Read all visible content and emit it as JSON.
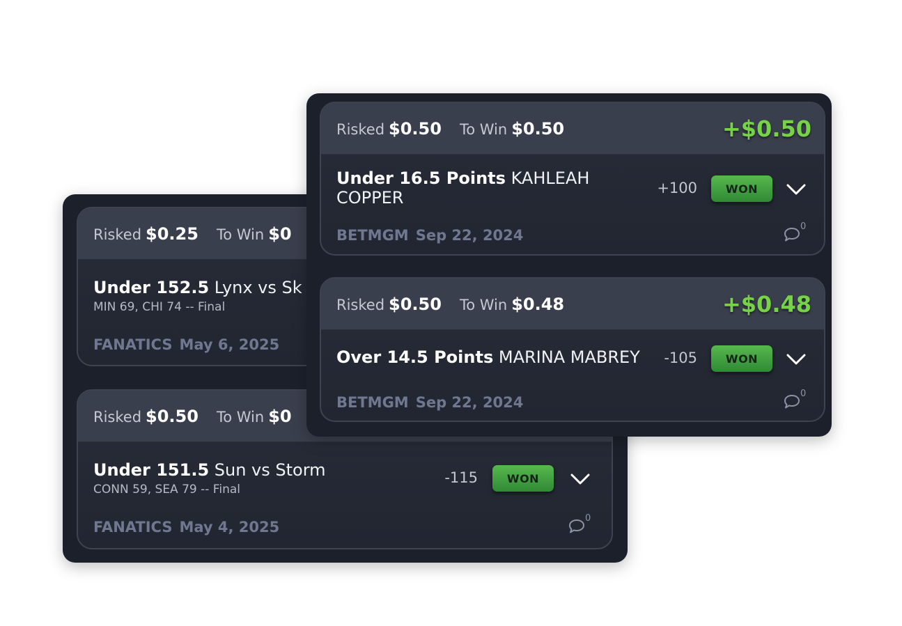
{
  "back_panel": {
    "cards": [
      {
        "risked_label": "Risked",
        "risked": "$0.25",
        "towin_label": "To Win",
        "towin": "$0",
        "title_bold": "Under 152.5",
        "title_rest": " Lynx vs Sk",
        "subtitle": "MIN 69, CHI 74 -- Final",
        "book": "FANATICS",
        "date": "May 6, 2025"
      },
      {
        "risked_label": "Risked",
        "risked": "$0.50",
        "towin_label": "To Win",
        "towin": "$0",
        "title_bold": "Under 151.5",
        "title_rest": " Sun vs Storm",
        "subtitle": "CONN 59, SEA 79 -- Final",
        "odds": "-115",
        "status": "WON",
        "book": "FANATICS",
        "date": "May 4, 2025",
        "comments": "0"
      }
    ]
  },
  "front_panel": {
    "cards": [
      {
        "risked_label": "Risked",
        "risked": "$0.50",
        "towin_label": "To Win",
        "towin": "$0.50",
        "profit": "+$0.50",
        "title_bold": "Under 16.5 Points",
        "title_rest": " KAHLEAH COPPER",
        "odds": "+100",
        "status": "WON",
        "book": "BETMGM",
        "date": "Sep 22, 2024",
        "comments": "0"
      },
      {
        "risked_label": "Risked",
        "risked": "$0.50",
        "towin_label": "To Win",
        "towin": "$0.48",
        "profit": "+$0.48",
        "title_bold": "Over 14.5 Points",
        "title_rest": " MARINA MABREY",
        "odds": "-105",
        "status": "WON",
        "book": "BETMGM",
        "date": "Sep 22, 2024",
        "comments": "0"
      }
    ]
  },
  "colors": {
    "profit": "#76d348",
    "won_badge": "#3e9e3c",
    "panel": "#1c202b"
  },
  "icons": {
    "expand": "chevron-down-icon",
    "comment": "comment-icon"
  }
}
